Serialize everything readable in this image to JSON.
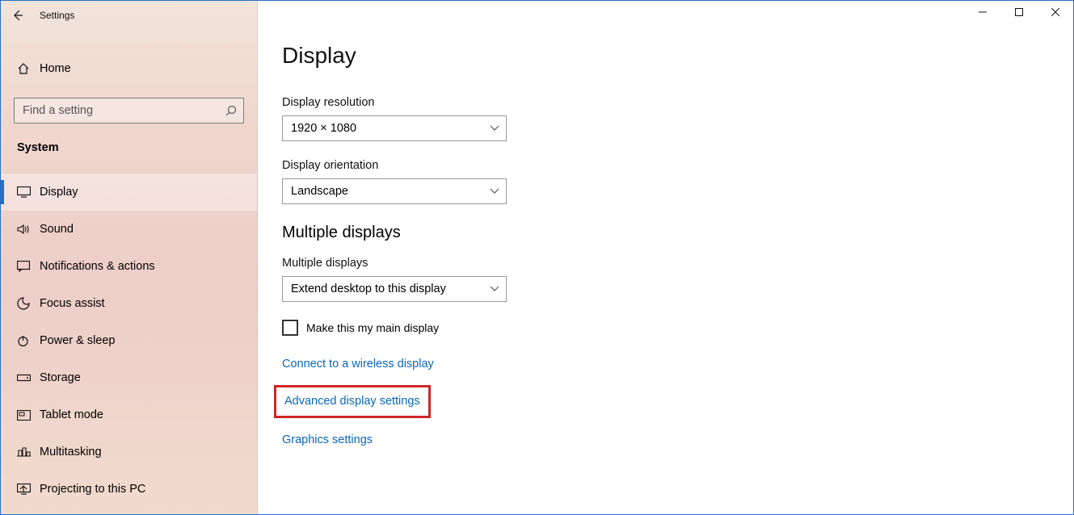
{
  "titlebar": {
    "title": "Settings"
  },
  "sidebar": {
    "home_label": "Home",
    "search_placeholder": "Find a setting",
    "section_label": "System",
    "items": [
      {
        "label": "Display"
      },
      {
        "label": "Sound"
      },
      {
        "label": "Notifications & actions"
      },
      {
        "label": "Focus assist"
      },
      {
        "label": "Power & sleep"
      },
      {
        "label": "Storage"
      },
      {
        "label": "Tablet mode"
      },
      {
        "label": "Multitasking"
      },
      {
        "label": "Projecting to this PC"
      }
    ]
  },
  "main": {
    "page_title": "Display",
    "resolution_label": "Display resolution",
    "resolution_value": "1920 × 1080",
    "orientation_label": "Display orientation",
    "orientation_value": "Landscape",
    "multi_heading": "Multiple displays",
    "multi_label": "Multiple displays",
    "multi_value": "Extend desktop to this display",
    "main_display_checkbox": "Make this my main display",
    "link_wireless": "Connect to a wireless display",
    "link_advanced": "Advanced display settings",
    "link_graphics": "Graphics settings"
  }
}
